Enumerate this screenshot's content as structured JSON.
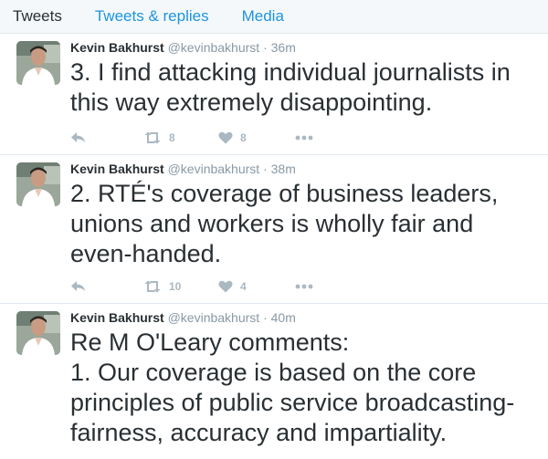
{
  "tabs": [
    {
      "label": "Tweets"
    },
    {
      "label": "Tweets & replies"
    },
    {
      "label": "Media"
    }
  ],
  "tweets": [
    {
      "name": "Kevin Bakhurst",
      "handle": "@kevinbakhurst",
      "separator": "·",
      "time": "36m",
      "lines": [
        "3. I find attacking individual journalists in",
        "this way extremely disappointing."
      ],
      "retweets": "8",
      "likes": "8"
    },
    {
      "name": "Kevin Bakhurst",
      "handle": "@kevinbakhurst",
      "separator": "·",
      "time": "38m",
      "lines": [
        "2. RTÉ's coverage of business leaders,",
        "unions and workers is wholly fair and",
        "even-handed."
      ],
      "retweets": "10",
      "likes": "4"
    },
    {
      "name": "Kevin Bakhurst",
      "handle": "@kevinbakhurst",
      "separator": "·",
      "time": "40m",
      "lines": [
        "Re M O'Leary comments:",
        "1. Our coverage is based on the core",
        "principles of public service broadcasting-",
        "fairness, accuracy and impartiality."
      ]
    }
  ],
  "colors": {
    "link": "#1b95e0",
    "icon": "#aab8c2",
    "meta": "#8899a6",
    "border": "#e1e8ed"
  },
  "icons": [
    "reply-icon",
    "retweet-icon",
    "heart-icon",
    "more-icon"
  ]
}
